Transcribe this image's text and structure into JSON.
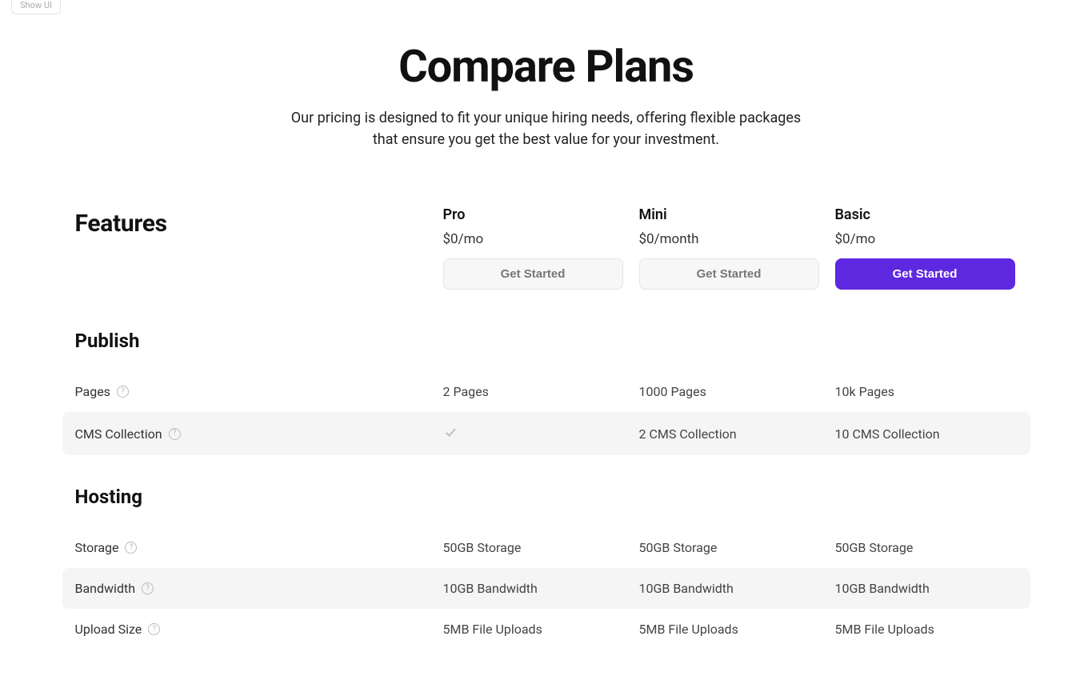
{
  "chip": "Show UI",
  "hero": {
    "title": "Compare Plans",
    "subtitle": "Our pricing is designed to fit your unique hiring needs, offering flexible packages that ensure you get the best value for your investment."
  },
  "features_heading": "Features",
  "plans": [
    {
      "name": "Pro",
      "price": "$0/mo",
      "cta": "Get Started",
      "primary": false
    },
    {
      "name": "Mini",
      "price": "$0/month",
      "cta": "Get Started",
      "primary": false
    },
    {
      "name": "Basic",
      "price": "$0/mo",
      "cta": "Get Started",
      "primary": true
    }
  ],
  "sections": [
    {
      "title": "Publish",
      "rows": [
        {
          "label": "Pages",
          "help": true,
          "cells": [
            "2 Pages",
            "1000 Pages",
            "10k Pages"
          ],
          "alt": false
        },
        {
          "label": "CMS Collection",
          "help": true,
          "cells": [
            "__check__",
            "2 CMS Collection",
            "10 CMS Collection"
          ],
          "alt": true
        }
      ]
    },
    {
      "title": "Hosting",
      "rows": [
        {
          "label": "Storage",
          "help": true,
          "cells": [
            "50GB Storage",
            "50GB Storage",
            "50GB Storage"
          ],
          "alt": false
        },
        {
          "label": "Bandwidth",
          "help": true,
          "cells": [
            "10GB Bandwidth",
            "10GB Bandwidth",
            "10GB Bandwidth"
          ],
          "alt": true
        },
        {
          "label": "Upload Size",
          "help": true,
          "cells": [
            "5MB File Uploads",
            "5MB File Uploads",
            "5MB File Uploads"
          ],
          "alt": false
        }
      ]
    }
  ]
}
